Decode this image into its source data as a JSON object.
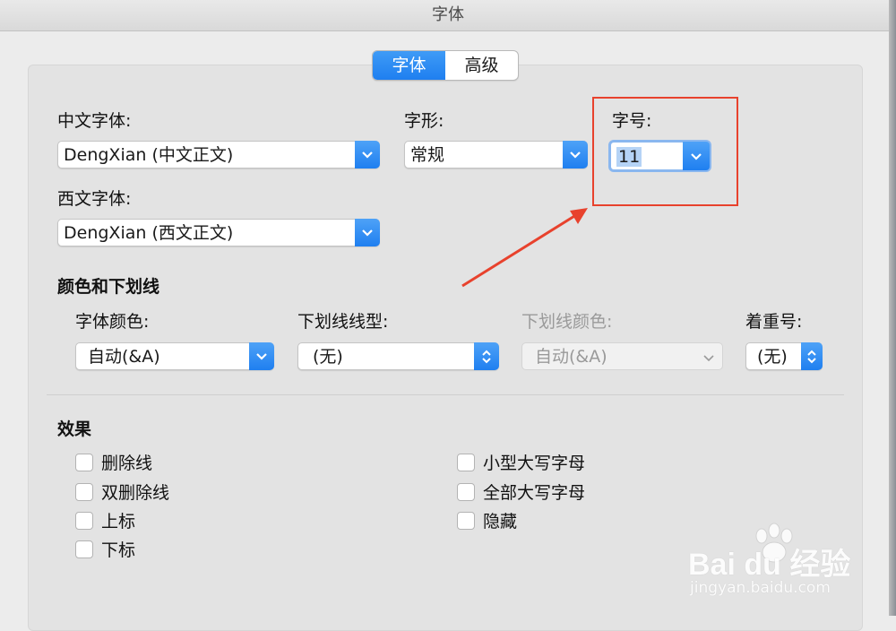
{
  "window": {
    "title": "字体"
  },
  "tabs": [
    {
      "label": "字体",
      "active": true
    },
    {
      "label": "高级",
      "active": false
    }
  ],
  "font": {
    "chinese_label": "中文字体:",
    "chinese_value": "DengXian (中文正文)",
    "style_label": "字形:",
    "style_value": "常规",
    "size_label": "字号:",
    "size_value": "11",
    "western_label": "西文字体:",
    "western_value": "DengXian (西文正文)"
  },
  "color_section": {
    "title": "颜色和下划线",
    "font_color_label": "字体颜色:",
    "font_color_value": "自动(&A)",
    "underline_style_label": "下划线线型:",
    "underline_style_value": "(无)",
    "underline_color_label": "下划线颜色:",
    "underline_color_value": "自动(&A)",
    "emphasis_label": "着重号:",
    "emphasis_value": "(无)"
  },
  "effects": {
    "title": "效果",
    "left": [
      "删除线",
      "双删除线",
      "上标",
      "下标"
    ],
    "right": [
      "小型大写字母",
      "全部大写字母",
      "隐藏"
    ]
  },
  "watermark": {
    "brand": "Bai du 经验",
    "url": "jingyan.baidu.com"
  },
  "colors": {
    "accent": "#1f7ff0",
    "annotation": "#e8422d"
  }
}
